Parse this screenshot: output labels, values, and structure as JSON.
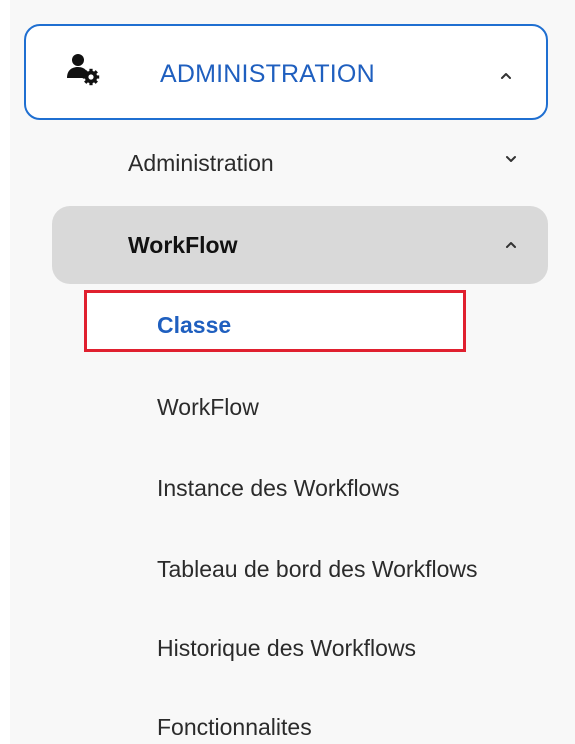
{
  "menu": {
    "section": {
      "label": "ADMINISTRATION",
      "icon": "user-gear-icon",
      "expanded": true,
      "accent_color": "#1f6fd1"
    },
    "administration": {
      "label": "Administration",
      "expanded": false
    },
    "workflow_group": {
      "label": "WorkFlow",
      "expanded": true,
      "background": "#d9d9d9"
    },
    "items": [
      {
        "label": "Classe",
        "selected": true,
        "highlight_color": "#e0202f"
      },
      {
        "label": "WorkFlow"
      },
      {
        "label": "Instance des Workflows"
      },
      {
        "label": "Tableau de bord des Workflows"
      },
      {
        "label": "Historique des Workflows"
      },
      {
        "label": "Fonctionnalites"
      }
    ]
  }
}
